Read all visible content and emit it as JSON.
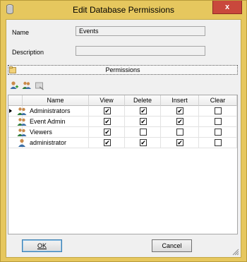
{
  "window": {
    "title": "Edit Database Permissions",
    "close_glyph": "x",
    "app_icon": "database-icon"
  },
  "form": {
    "name_label": "Name",
    "name_value": "Events",
    "description_label": "Description",
    "description_value": ""
  },
  "permissions": {
    "header": "Permissions",
    "toolbar_icons": [
      "add-user-icon",
      "add-group-icon",
      "remove-icon"
    ],
    "columns": [
      "Name",
      "View",
      "Delete",
      "Insert",
      "Clear"
    ],
    "rows": [
      {
        "name": "Administrators",
        "icon": "group-icon",
        "selected": true,
        "view": true,
        "delete": true,
        "insert": true,
        "clear": false
      },
      {
        "name": "Event Admin",
        "icon": "group-icon",
        "selected": false,
        "view": true,
        "delete": true,
        "insert": true,
        "clear": false
      },
      {
        "name": "Viewers",
        "icon": "group-icon",
        "selected": false,
        "view": true,
        "delete": false,
        "insert": false,
        "clear": false
      },
      {
        "name": "administrator",
        "icon": "user-icon",
        "selected": false,
        "view": true,
        "delete": true,
        "insert": true,
        "clear": false
      }
    ]
  },
  "buttons": {
    "ok_label": "OK",
    "cancel_label": "Cancel"
  },
  "colors": {
    "title_bar": "#e6c75e",
    "close_button": "#c9483c",
    "client_bg": "#f0f0f0"
  }
}
